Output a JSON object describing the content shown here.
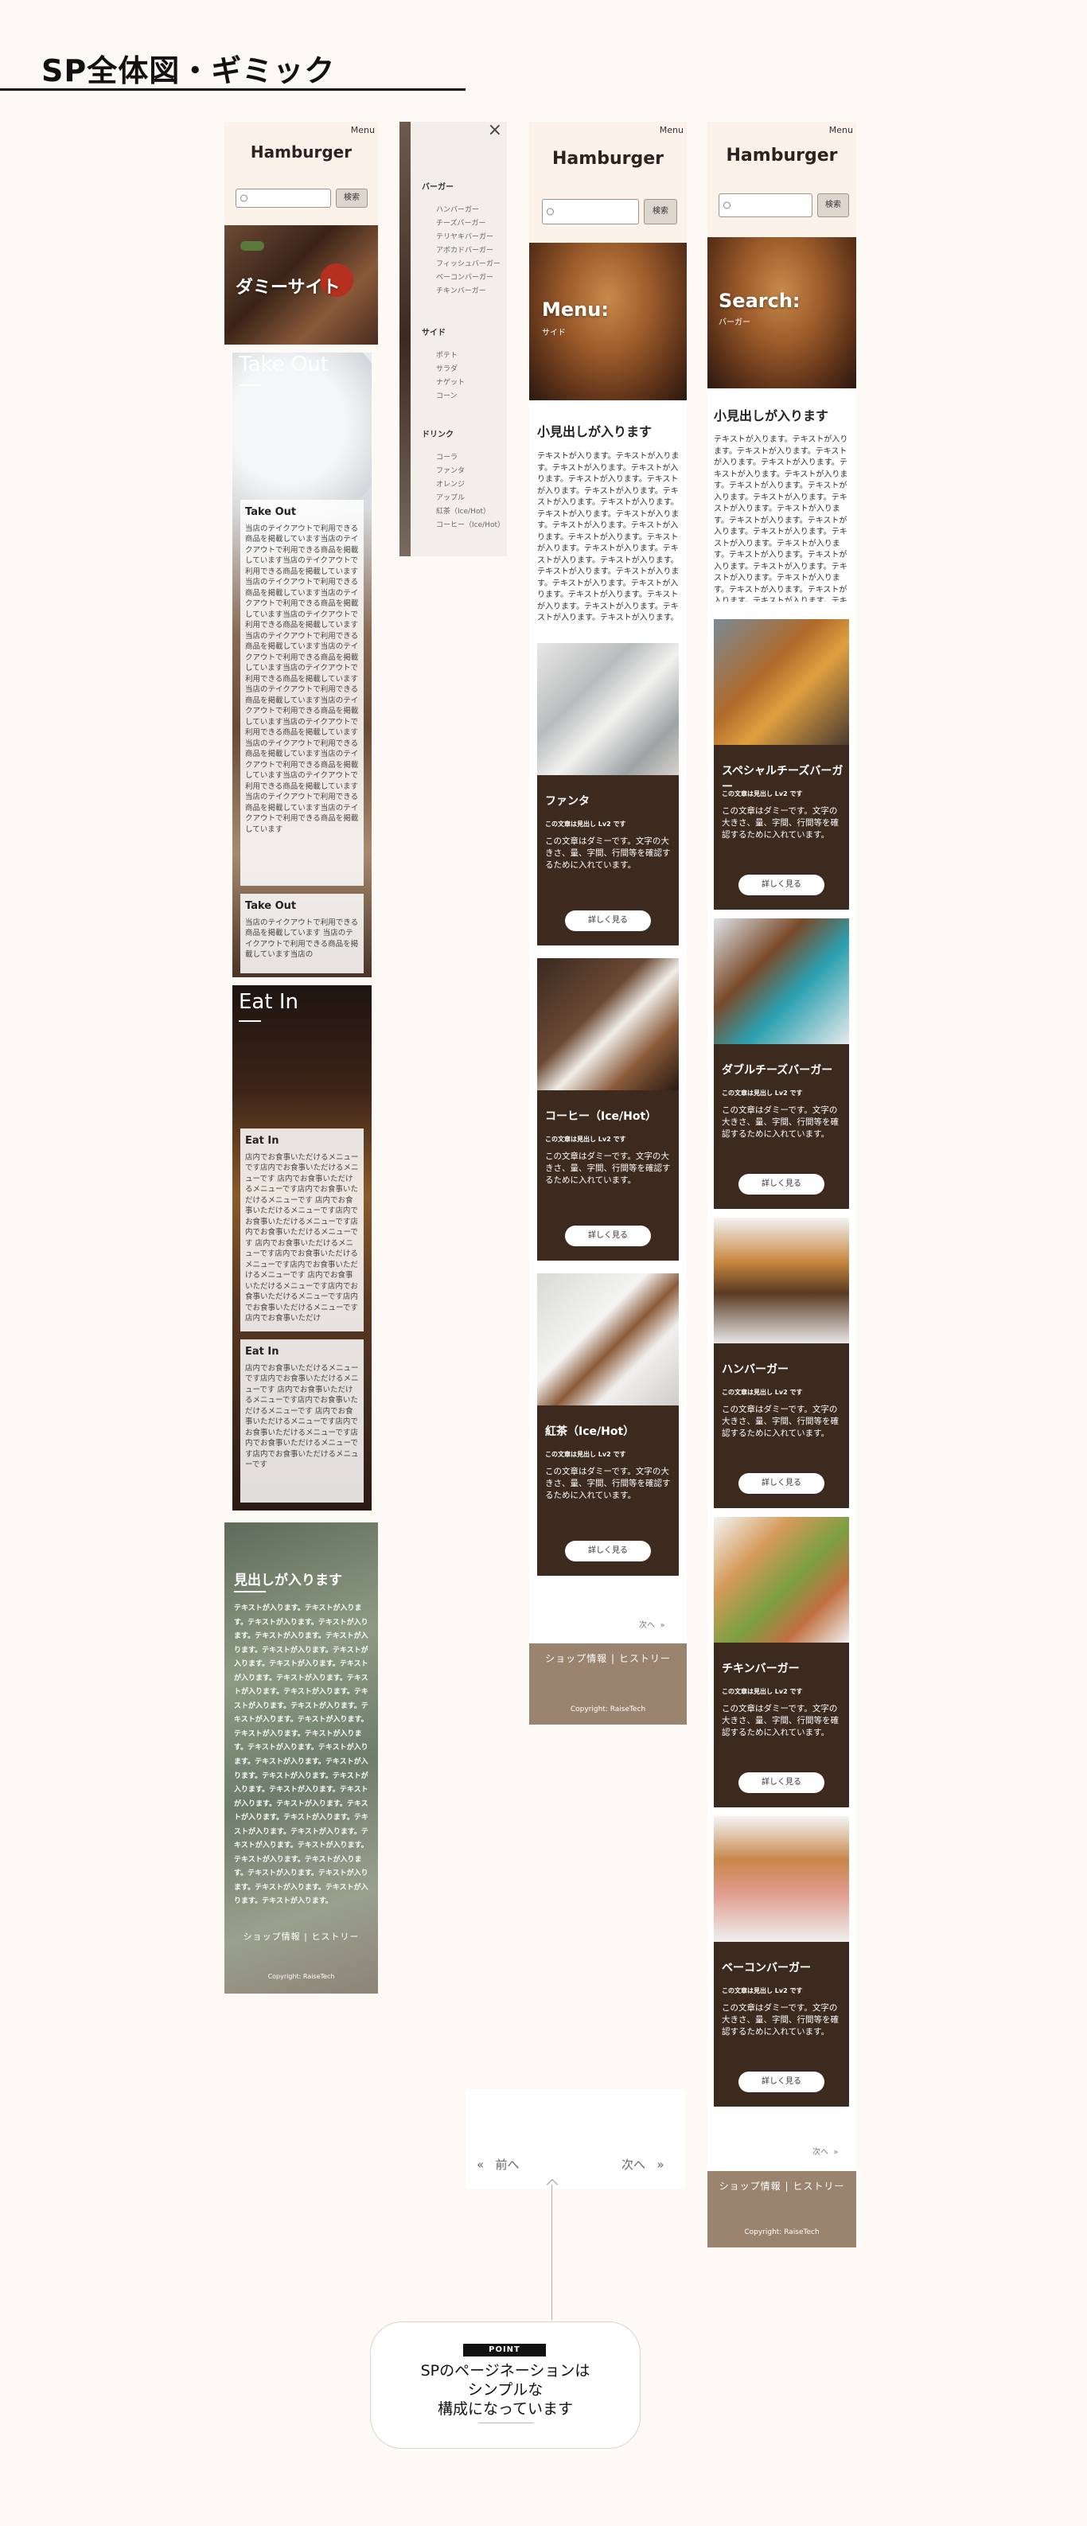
{
  "page": {
    "title": "SP全体図・ギミック"
  },
  "header": {
    "title": "Hamburger",
    "menu_label": "Menu",
    "search_placeholder": "",
    "search_button": "検索"
  },
  "colors": {
    "accent_brown": "#3d2a1f",
    "footer_brown": "#9a8470",
    "header_cream": "#fbf2ea",
    "background": "#fdfaf6"
  },
  "icons": {
    "search": "search-icon",
    "close": "close-icon",
    "chevron_right": "chevron-right-icon",
    "chevron_left": "chevron-left-icon",
    "arrow_up": "arrow-up-icon"
  },
  "home": {
    "hero_title": "ダミーサイト",
    "takeout": {
      "title": "Take Out",
      "panel1_title": "Take Out",
      "panel1_text": "当店のテイクアウトで利用できる商品を掲載しています当店のテイクアウトで利用できる商品を掲載しています当店のテイクアウトで利用できる商品を掲載しています当店のテイクアウトで利用できる商品を掲載しています当店のテイクアウトで利用できる商品を掲載しています当店のテイクアウトで利用できる商品を掲載しています当店のテイクアウトで利用できる商品を掲載しています当店のテイクアウトで利用できる商品を掲載しています当店のテイクアウトで利用できる商品を掲載しています当店のテイクアウトで利用できる商品を掲載しています当店のテイクアウトで利用できる商品を掲載しています当店のテイクアウトで利用できる商品を掲載しています当店のテイクアウトで利用できる商品を掲載しています当店のテイクアウトで利用できる商品を掲載しています当店のテイクアウトで利用できる商品を掲載しています当店のテイクアウトで利用できる商品を掲載しています当店のテイクアウトで利用できる商品を掲載しています",
      "panel2_title": "Take Out",
      "panel2_text": "当店のテイクアウトで利用できる商品を掲載しています 当店のテイクアウトで利用できる商品を掲載しています当店の"
    },
    "eatin": {
      "title": "Eat In",
      "panel1_title": "Eat In",
      "panel1_text": "店内でお食事いただけるメニューです店内でお食事いただけるメニューです 店内でお食事いただけるメニューです店内でお食事いただけるメニューです 店内でお食事いただけるメニューです店内でお食事いただけるメニューです店内でお食事いただけるメニューです 店内でお食事いただけるメニューです店内でお食事いただけるメニューです店内でお食事いただけるメニューです 店内でお食事いただけるメニューです店内でお食事いただけるメニューです店内でお食事いただけるメニューです店内でお食事いただけ",
      "panel2_title": "Eat In",
      "panel2_text": "店内でお食事いただけるメニューです店内でお食事いただけるメニューです 店内でお食事いただけるメニューです店内でお食事いただけるメニューです 店内でお食事いただけるメニューです店内でお食事いただけるメニューです店内でお食事いただけるメニューです店内でお食事いただけるメニューです"
    },
    "map_section": {
      "heading": "見出しが入ります",
      "text": "テキストが入ります。テキストが入ります。テキストが入ります。テキストが入ります。テキストが入ります。テキストが入ります。テキストが入ります。テキストが入ります。テキストが入ります。テキストが入ります。テキストが入ります。テキストが入ります。テキストが入ります。テキストが入ります。テキストが入ります。テキストが入ります。テキストが入ります。テキストが入ります。テキストが入ります。テキストが入ります。テキストが入ります。テキストが入ります。テキストが入ります。テキストが入ります。テキストが入ります。テキストが入ります。テキストが入ります。テキストが入ります。テキストが入ります。テキストが入ります。テキストが入ります。テキストが入ります。テキストが入ります。テキストが入ります。テキストが入ります。テキストが入ります。テキストが入ります。テキストが入ります。テキストが入ります。テキストが入ります。テキストが入ります。"
    }
  },
  "footer": {
    "links": "ショップ情報 | ヒストリー",
    "copyright": "Copyright: RaiseTech"
  },
  "drawer": {
    "sections": [
      {
        "title": "バーガー",
        "items": [
          "ハンバーガー",
          "チーズバーガー",
          "テリヤキバーガー",
          "アボカドバーガー",
          "フィッシュバーガー",
          "ベーコンバーガー",
          "チキンバーガー"
        ]
      },
      {
        "title": "サイド",
        "items": [
          "ポテト",
          "サラダ",
          "ナゲット",
          "コーン"
        ]
      },
      {
        "title": "ドリンク",
        "items": [
          "コーラ",
          "ファンタ",
          "オレンジ",
          "アップル",
          "紅茶（Ice/Hot）",
          "コーヒー（Ice/Hot）"
        ]
      }
    ]
  },
  "menu_page": {
    "hero_title": "Menu:",
    "hero_sub": "サイド",
    "heading": "小見出しが入ります",
    "text": "テキストが入ります。テキストが入ります。テキストが入ります。テキストが入ります。テキストが入ります。テキストが入ります。テキストが入ります。テキストが入ります。テキストが入ります。テキストが入ります。テキストが入ります。テキストが入ります。テキストが入ります。テキストが入ります。テキストが入ります。テキストが入ります。テキストが入ります。テキストが入ります。テキストが入ります。テキストが入ります。テキストが入ります。テキストが入ります。テキストが入ります。テキストが入ります。テキストが入ります。テキストが入ります。テキストが入ります。",
    "products": [
      {
        "name": "ファンタ",
        "sub": "この文章は見出し Lv2 です",
        "desc": "この文章はダミーです。文字の大きさ、量、字間、行間等を確認するために入れています。",
        "button": "詳しく見る"
      },
      {
        "name": "コーヒー（Ice/Hot）",
        "sub": "この文章は見出し Lv2 です",
        "desc": "この文章はダミーです。文字の大きさ、量、字間、行間等を確認するために入れています。",
        "button": "詳しく見る"
      },
      {
        "name": "紅茶（Ice/Hot）",
        "sub": "この文章は見出し Lv2 です",
        "desc": "この文章はダミーです。文字の大きさ、量、字間、行間等を確認するために入れています。",
        "button": "詳しく見る"
      }
    ],
    "next": "次へ"
  },
  "search_page": {
    "hero_title": "Search:",
    "hero_sub": "バーガー",
    "heading": "小見出しが入ります",
    "text": "テキストが入ります。テキストが入ります。テキストが入ります。テキストが入ります。テキストが入ります。テキストが入ります。テキストが入ります。テキストが入ります。テキストが入ります。テキストが入ります。テキストが入ります。テキストが入ります。テキストが入ります。テキストが入ります。テキストが入ります。テキストが入ります。テキストが入ります。テキストが入ります。テキストが入ります。テキストが入ります。テキストが入ります。テキストが入ります。テキストが入ります。テキストが入ります。テキストが入ります。テキストが入ります。",
    "products": [
      {
        "name": "スペシャルチーズバーガー",
        "sub": "この文章は見出し Lv2 です",
        "desc": "この文章はダミーです。文字の大きさ、量、字間、行間等を確認するために入れています。",
        "button": "詳しく見る"
      },
      {
        "name": "ダブルチーズバーガー",
        "sub": "この文章は見出し Lv2 です",
        "desc": "この文章はダミーです。文字の大きさ、量、字間、行間等を確認するために入れています。",
        "button": "詳しく見る"
      },
      {
        "name": "ハンバーガー",
        "sub": "この文章は見出し Lv2 です",
        "desc": "この文章はダミーです。文字の大きさ、量、字間、行間等を確認するために入れています。",
        "button": "詳しく見る"
      },
      {
        "name": "チキンバーガー",
        "sub": "この文章は見出し Lv2 です",
        "desc": "この文章はダミーです。文字の大きさ、量、字間、行間等を確認するために入れています。",
        "button": "詳しく見る"
      },
      {
        "name": "ベーコンバーガー",
        "sub": "この文章は見出し Lv2 です",
        "desc": "この文章はダミーです。文字の大きさ、量、字間、行間等を確認するために入れています。",
        "button": "詳しく見る"
      }
    ],
    "next": "次へ"
  },
  "pagination_detail": {
    "prev": "前へ",
    "next": "次へ"
  },
  "callout": {
    "tag": "POINT",
    "line1": "SPのページネーションは",
    "line2": "シンプルな",
    "line3": "構成になっています"
  }
}
